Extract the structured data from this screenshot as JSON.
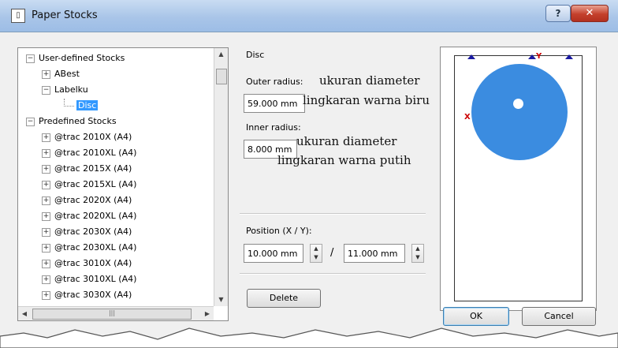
{
  "window": {
    "title": "Paper Stocks",
    "help_label": "?",
    "close_label": "✕"
  },
  "tree": {
    "items": [
      {
        "label": "User-defined Stocks",
        "expander": "−"
      },
      {
        "label": "ABest",
        "expander": "+"
      },
      {
        "label": "Labelku",
        "expander": "−"
      },
      {
        "label": "Disc",
        "expander": ""
      },
      {
        "label": "Predefined Stocks",
        "expander": "−"
      },
      {
        "label": "@trac 2010X (A4)",
        "expander": "+"
      },
      {
        "label": "@trac 2010XL (A4)",
        "expander": "+"
      },
      {
        "label": "@trac 2015X (A4)",
        "expander": "+"
      },
      {
        "label": "@trac 2015XL (A4)",
        "expander": "+"
      },
      {
        "label": "@trac 2020X (A4)",
        "expander": "+"
      },
      {
        "label": "@trac 2020XL (A4)",
        "expander": "+"
      },
      {
        "label": "@trac 2030X (A4)",
        "expander": "+"
      },
      {
        "label": "@trac 2030XL (A4)",
        "expander": "+"
      },
      {
        "label": "@trac 3010X (A4)",
        "expander": "+"
      },
      {
        "label": "@trac 3010XL (A4)",
        "expander": "+"
      },
      {
        "label": "@trac 3030X (A4)",
        "expander": "+"
      }
    ],
    "selected": "Disc"
  },
  "form": {
    "section_title": "Disc",
    "outer_label": "Outer radius:",
    "outer_value": "59.000 mm",
    "inner_label": "Inner radius:",
    "inner_value": "8.000 mm",
    "position_label": "Position (X / Y):",
    "pos_x": "10.000 mm",
    "pos_sep": "/",
    "pos_y": "11.000 mm",
    "delete_label": "Delete"
  },
  "annotations": {
    "outer_line1": "ukuran diameter",
    "outer_line2": "lingkaran warna biru",
    "inner_line1": "ukuran diameter",
    "inner_line2": "lingkaran warna putih"
  },
  "preview": {
    "x_axis": "X",
    "y_axis": "Y",
    "disc_color": "#3b8ce0"
  },
  "buttons": {
    "ok": "OK",
    "cancel": "Cancel"
  }
}
